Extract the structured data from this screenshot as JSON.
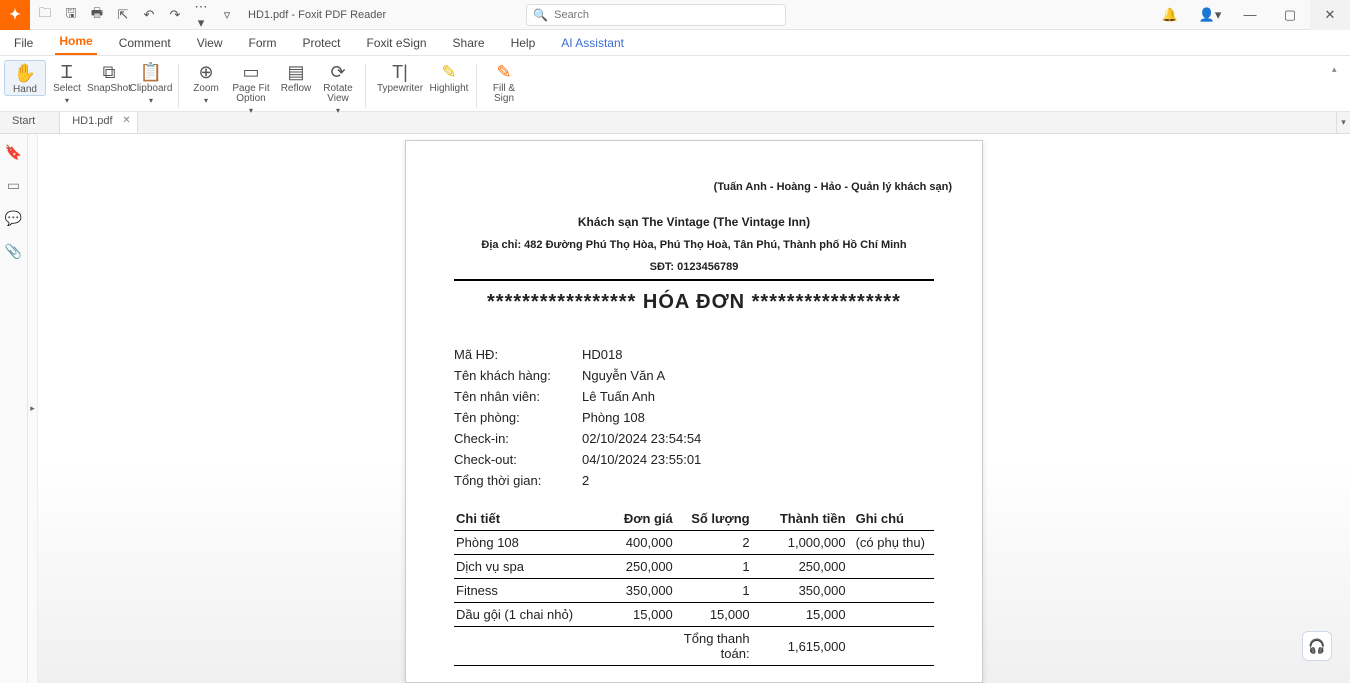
{
  "titlebar": {
    "app_title": "HD1.pdf - Foxit PDF Reader",
    "search_placeholder": "Search"
  },
  "menu": {
    "items": [
      "File",
      "Home",
      "Comment",
      "View",
      "Form",
      "Protect",
      "Foxit eSign",
      "Share",
      "Help"
    ],
    "ai": "AI Assistant",
    "active": "Home"
  },
  "ribbon": {
    "items": [
      {
        "label": "Hand",
        "icon": "✋"
      },
      {
        "label": "Select",
        "icon": "Ꮖ",
        "drop": true
      },
      {
        "label": "SnapShot",
        "icon": "⧉"
      },
      {
        "label": "Clipboard",
        "icon": "📋",
        "drop": true
      },
      {
        "label": "Zoom",
        "icon": "⊕",
        "drop": true
      },
      {
        "label": "Page Fit Option",
        "icon": "▭",
        "drop": true
      },
      {
        "label": "Reflow",
        "icon": "▤"
      },
      {
        "label": "Rotate View",
        "icon": "⟳",
        "drop": true
      },
      {
        "label": "Typewriter",
        "icon": "T|"
      },
      {
        "label": "Highlight",
        "icon": "✎"
      },
      {
        "label": "Fill & Sign",
        "icon": "✎"
      }
    ]
  },
  "tabs": {
    "start": "Start",
    "doc": "HD1.pdf"
  },
  "document": {
    "subtitle": "(Tuấn Anh - Hoàng - Hảo - Quản lý khách sạn)",
    "hotel": "Khách sạn The Vintage (The Vintage Inn)",
    "addr_label": "Địa chỉ:",
    "addr": "482 Đường Phú Thọ Hòa, Phú Thọ Hoà, Tân Phú, Thành phố Hồ Chí Minh",
    "phone_label": "SĐT:",
    "phone": "0123456789",
    "heading": "***************** HÓA ĐƠN *****************",
    "info": [
      {
        "label": "Mã HĐ:",
        "value": "HD018"
      },
      {
        "label": "Tên khách hàng:",
        "value": "Nguyễn Văn A"
      },
      {
        "label": "Tên nhân viên:",
        "value": "Lê Tuấn Anh"
      },
      {
        "label": "Tên phòng:",
        "value": "Phòng 108"
      },
      {
        "label": "Check-in:",
        "value": "02/10/2024 23:54:54"
      },
      {
        "label": "Check-out:",
        "value": "04/10/2024 23:55:01"
      },
      {
        "label": "Tổng thời gian:",
        "value": "2"
      }
    ],
    "columns": [
      "Chi tiết",
      "Đơn giá",
      "Số lượng",
      "Thành tiền",
      "Ghi chú"
    ],
    "rows": [
      {
        "c0": "Phòng 108",
        "c1": "400,000",
        "c2": "2",
        "c3": "1,000,000",
        "c4": "(có phụ thu)"
      },
      {
        "c0": "Dịch vụ spa",
        "c1": "250,000",
        "c2": "1",
        "c3": "250,000",
        "c4": ""
      },
      {
        "c0": "Fitness",
        "c1": "350,000",
        "c2": "1",
        "c3": "350,000",
        "c4": ""
      },
      {
        "c0": "Dầu gội (1 chai nhỏ)",
        "c1": "15,000",
        "c2": "15,000",
        "c3": "15,000",
        "c4": ""
      }
    ],
    "total_label": "Tổng thanh toán:",
    "total": "1,615,000"
  }
}
